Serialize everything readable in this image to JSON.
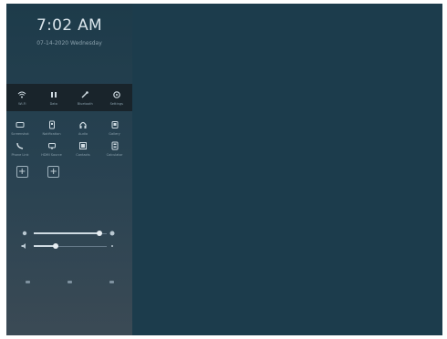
{
  "clock": {
    "time": "7:02 AM",
    "date": "07-14-2020 Wednesday"
  },
  "quick_tiles": [
    {
      "label": "Wi-Fi",
      "icon": "wifi-icon"
    },
    {
      "label": "Data",
      "icon": "mobile-data-icon"
    },
    {
      "label": "Bluetooth",
      "icon": "bluetooth-icon"
    },
    {
      "label": "Settings",
      "icon": "settings-icon"
    }
  ],
  "grid_tiles": [
    {
      "label": "Screenshot",
      "icon": "screenshot-icon"
    },
    {
      "label": "Notification",
      "icon": "notification-icon"
    },
    {
      "label": "Audio",
      "icon": "headphones-icon"
    },
    {
      "label": "Gallery",
      "icon": "gallery-icon"
    },
    {
      "label": "Phone Link",
      "icon": "phone-icon"
    },
    {
      "label": "HDMI Source",
      "icon": "hdmi-icon"
    },
    {
      "label": "Contacts",
      "icon": "contacts-icon"
    },
    {
      "label": "Calculator",
      "icon": "calculator-icon"
    }
  ],
  "add_buttons": [
    "+",
    "+"
  ],
  "sliders": {
    "brightness": {
      "level": 0.9
    },
    "volume": {
      "level": 0.3
    }
  },
  "colors": {
    "background": "#1c3c4c",
    "panel_top": "#1d3b4a",
    "panel_bottom": "#3b4a55",
    "quick_bar": "#19242b"
  }
}
